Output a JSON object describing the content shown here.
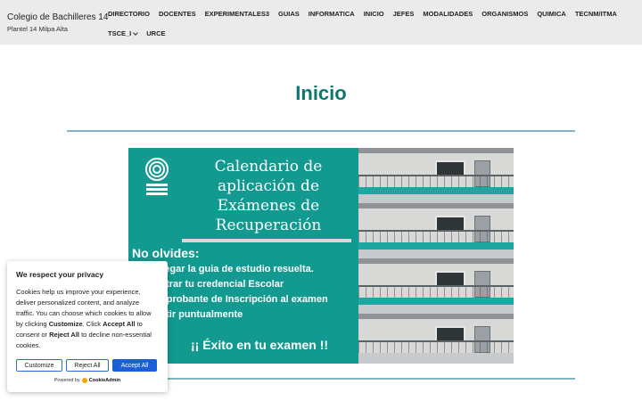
{
  "site": {
    "title": "Colegio de Bachilleres 14",
    "subtitle": "Plantel 14 Milpa Alta"
  },
  "nav": {
    "items": [
      {
        "label": "DIRECTORIO"
      },
      {
        "label": "DOCENTES"
      },
      {
        "label": "EXPERIMENTALES3"
      },
      {
        "label": "GUIAS"
      },
      {
        "label": "INFORMATICA"
      },
      {
        "label": "INICIO"
      },
      {
        "label": "JEFES"
      },
      {
        "label": "MODALIDADES"
      },
      {
        "label": "ORGANISMOS"
      },
      {
        "label": "QUIMICA"
      },
      {
        "label": "TECNM/ITMA"
      },
      {
        "label": "TSCE_I"
      },
      {
        "label": "URCE"
      }
    ]
  },
  "main": {
    "page_title": "Inicio"
  },
  "banner": {
    "title_lines": [
      "Calendario de",
      "aplicación de",
      "Exámenes de",
      "Recuperación"
    ],
    "reminder": "No olvides:",
    "items": [
      "regar la guia de estudio resuelta.",
      "strar tu credencial Escolar",
      "nprobante de Inscripción al examen",
      "stir puntualmente"
    ],
    "closing": "¡¡ Éxito en tu examen !!"
  },
  "cookie": {
    "title": "We respect your privacy",
    "body_1": "Cookies help us improve your experience, deliver personalized content, and analyze traffic. You can choose which cookies to allow by clicking ",
    "customize_word": "Customize",
    "body_2": ". Click ",
    "accept_all_word": "Accept All",
    "body_3": " to consent or ",
    "reject_all_word": "Reject All",
    "body_4": " to decline non-essential cookies.",
    "customize_button": "Customize",
    "reject_button": "Reject All",
    "accept_button": "Accept All",
    "powered_by": "Powered by",
    "brand_name": "CookieAdmin"
  },
  "colors": {
    "accent_teal": "#0f766e",
    "banner_teal": "#129a90",
    "cookie_primary": "#1a5fd6"
  }
}
